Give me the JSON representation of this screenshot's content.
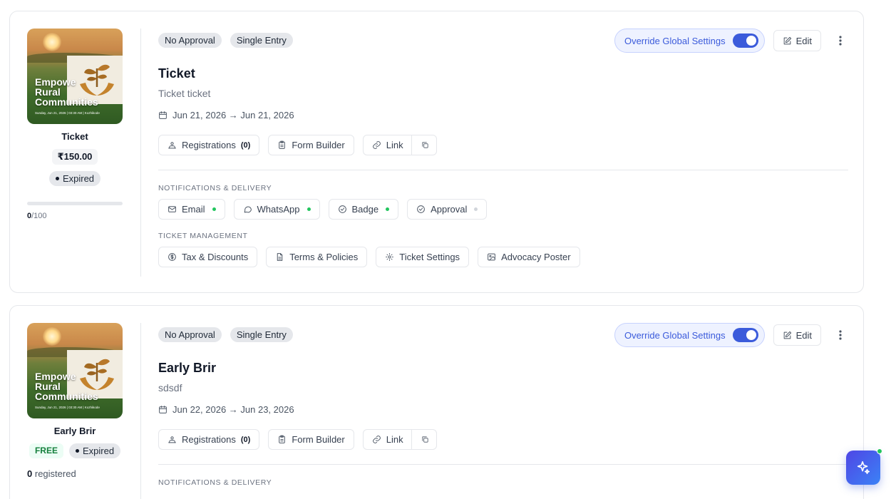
{
  "tickets": [
    {
      "thumb": {
        "title_lines": [
          "Empowe",
          "Rural",
          "Communities"
        ],
        "subtitle": "Sunday, Jun 21, 2026 | 03:30 AM | Kozhikode"
      },
      "name": "Ticket",
      "price": "₹150.00",
      "status": "Expired",
      "sold": "0",
      "capacity": "/100",
      "progress": 0,
      "tags": [
        "No Approval",
        "Single Entry"
      ],
      "override_label": "Override Global Settings",
      "override_on": true,
      "edit_label": "Edit",
      "title": "Ticket",
      "description": "Ticket ticket",
      "dates": "Jun 21, 2026 → Jun 21, 2026",
      "registrations_label": "Registrations",
      "registrations_count": "(0)",
      "form_builder_label": "Form Builder",
      "link_label": "Link",
      "notifications_heading": "NOTIFICATIONS & DELIVERY",
      "notifications": [
        {
          "label": "Email",
          "active": true,
          "icon": "mail-icon"
        },
        {
          "label": "WhatsApp",
          "active": true,
          "icon": "message-icon"
        },
        {
          "label": "Badge",
          "active": true,
          "icon": "check-circle-icon"
        },
        {
          "label": "Approval",
          "active": false,
          "icon": "check-circle-icon"
        }
      ],
      "management_heading": "TICKET MANAGEMENT",
      "management": [
        {
          "label": "Tax & Discounts",
          "icon": "dollar-circle-icon"
        },
        {
          "label": "Terms & Policies",
          "icon": "document-icon"
        },
        {
          "label": "Ticket Settings",
          "icon": "settings-icon"
        },
        {
          "label": "Advocacy Poster",
          "icon": "image-icon"
        }
      ]
    },
    {
      "thumb": {
        "title_lines": [
          "Empowe",
          "Rural",
          "Communities"
        ],
        "subtitle": "Sunday, Jun 21, 2026 | 03:30 AM | Kozhikode"
      },
      "name": "Early Brir",
      "price": "FREE",
      "status": "Expired",
      "registered_count": "0",
      "registered_label": "registered",
      "tags": [
        "No Approval",
        "Single Entry"
      ],
      "override_label": "Override Global Settings",
      "override_on": true,
      "edit_label": "Edit",
      "title": "Early Brir",
      "description": "sdsdf",
      "dates": "Jun 22, 2026 → Jun 23, 2026",
      "registrations_label": "Registrations",
      "registrations_count": "(0)",
      "form_builder_label": "Form Builder",
      "link_label": "Link",
      "notifications_heading": "NOTIFICATIONS & DELIVERY"
    }
  ],
  "colors": {
    "accent": "#3b5bdb",
    "active_dot": "#22c55e",
    "inactive_dot": "#d1d5db"
  },
  "fab": {
    "icon": "sparkle-icon"
  }
}
